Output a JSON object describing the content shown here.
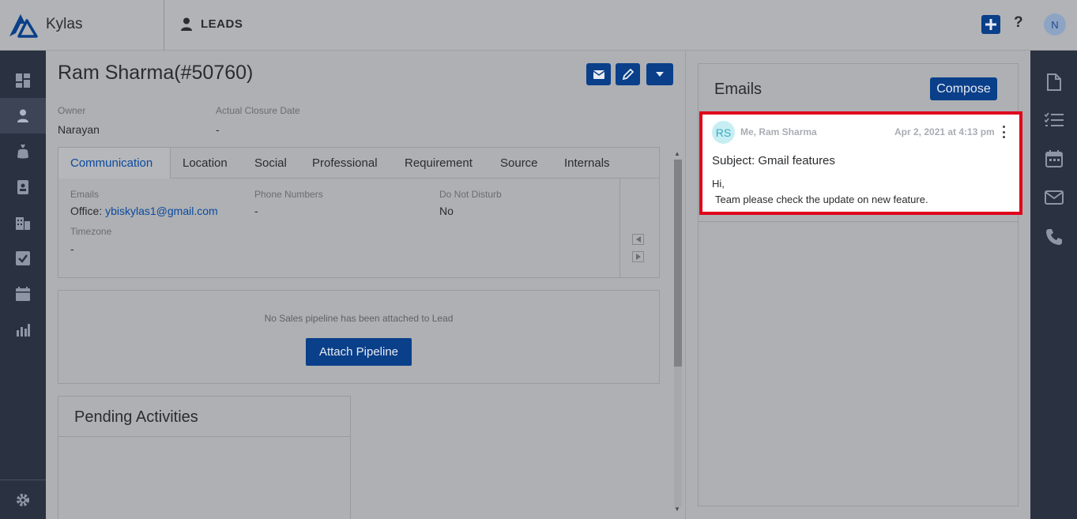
{
  "header": {
    "app_name": "Kylas",
    "module_label": "LEADS",
    "help_label": "?",
    "avatar_initial": "N"
  },
  "lead": {
    "title": "Ram Sharma(#50760)",
    "owner_label": "Owner",
    "owner_value": "Narayan",
    "closure_label": "Actual Closure Date",
    "closure_value": "-"
  },
  "tabs": [
    {
      "label": "Communication",
      "active": true
    },
    {
      "label": "Location"
    },
    {
      "label": "Social"
    },
    {
      "label": "Professional"
    },
    {
      "label": "Requirement"
    },
    {
      "label": "Source"
    },
    {
      "label": "Internals"
    }
  ],
  "communication": {
    "emails_label": "Emails",
    "emails_prefix": "Office: ",
    "emails_value": "ybiskylas1@gmail.com",
    "phone_label": "Phone Numbers",
    "phone_value": "-",
    "dnd_label": "Do Not Disturb",
    "dnd_value": "No",
    "timezone_label": "Timezone",
    "timezone_value": "-"
  },
  "pipeline": {
    "message": "No Sales pipeline has been attached to Lead",
    "button_label": "Attach Pipeline"
  },
  "pending": {
    "title": "Pending Activities"
  },
  "emails": {
    "title": "Emails",
    "compose_label": "Compose",
    "items": [
      {
        "avatar": "RS",
        "from": "Me, Ram Sharma",
        "date": "Apr 2, 2021 at 4:13 pm",
        "subject": "Subject: Gmail features",
        "body_line1": "Hi,",
        "body_line2": "Team please check the update on new feature."
      }
    ]
  },
  "colors": {
    "primary": "#0a3f8a",
    "highlight": "#e0001b",
    "sidebar": "#2a3140"
  },
  "icons": {
    "left_nav": [
      "dashboard-icon",
      "leads-icon",
      "deals-icon",
      "contacts-icon",
      "companies-icon",
      "tasks-icon",
      "calendar-icon",
      "reports-icon",
      "settings-icon"
    ],
    "right_nav": [
      "document-icon",
      "checklist-icon",
      "calendar-icon",
      "email-icon",
      "phone-icon"
    ]
  }
}
